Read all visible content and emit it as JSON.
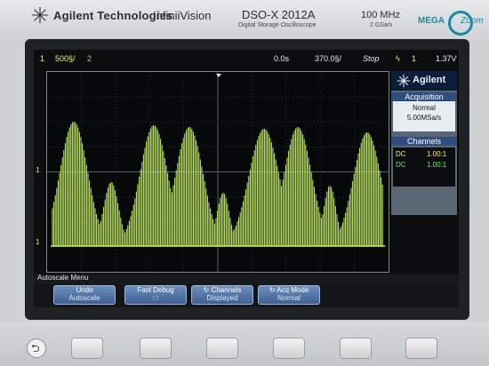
{
  "header": {
    "brand": "Agilent Technologies",
    "model_name": "InfiniiVision",
    "model_number": "DSO-X 2012A",
    "model_description": "Digital Storage Oscilloscope",
    "bandwidth": "100 MHz",
    "sample_rate": "2 GSa/s",
    "mega_text": "MEGA",
    "zoom_text": "Zoom"
  },
  "status": {
    "ch1_badge": "1",
    "ch1_scale": "500§/",
    "ch2_badge": "2",
    "time_position": "0.0s",
    "time_scale": "370.0§/",
    "run_state": "Stop",
    "trigger_icon": "ϟ",
    "trigger_source": "1",
    "trigger_level": "1.37V"
  },
  "panel": {
    "brand": "Agilent",
    "acquisition_title": "Acquisition",
    "acquisition_mode": "Normal",
    "acquisition_rate": "5.00MSa/s",
    "channels_title": "Channels",
    "channels": [
      {
        "coupling": "DC",
        "probe": "1.00:1",
        "color": "#f5f05c"
      },
      {
        "coupling": "DC",
        "probe": "1.00:1",
        "color": "#7fe07a"
      }
    ]
  },
  "markers": {
    "ch1_level": "1",
    "ch1_ground": "1"
  },
  "menu": {
    "title": "Autoscale Menu",
    "softkeys": [
      {
        "line1": "Undo",
        "line2": "Autoscale"
      },
      {
        "line1": "Fast Debug",
        "line2": "□"
      },
      {
        "line1": "Channels",
        "line2": "Displayed"
      },
      {
        "line1": "Acq Mode",
        "line2": "Normal"
      }
    ]
  },
  "colors": {
    "trace": "#c8f26a",
    "ch1": "#f5f05c",
    "ch2": "#7fe07a",
    "panel_header": "#0c1d3a",
    "softkey": "#4f73a8"
  }
}
